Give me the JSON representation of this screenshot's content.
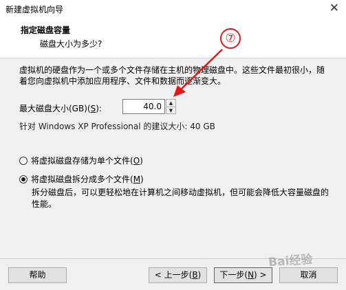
{
  "window": {
    "title": "新建虚拟机向导",
    "close_glyph": "✕"
  },
  "header": {
    "title": "指定磁盘容量",
    "subtitle": "磁盘大小为多少?"
  },
  "description": "虚拟机的硬盘作为一个或多个文件存储在主机的物理磁盘中。这些文件最初很小，随着您向虚拟机中添加应用程序、文件和数据而逐渐变大。",
  "disk_size": {
    "label_pre": "最大磁盘大小(GB)(",
    "label_key": "S",
    "label_post": "):",
    "value": "40.0"
  },
  "recommendation": "针对 Windows XP Professional 的建议大小: 40 GB",
  "options": {
    "single": {
      "label_pre": "将虚拟磁盘存储为单个文件(",
      "label_key": "O",
      "label_post": ")",
      "selected": false
    },
    "multi": {
      "label_pre": "将虚拟磁盘拆分成多个文件(",
      "label_key": "M",
      "label_post": ")",
      "selected": true
    },
    "multi_description": "拆分磁盘后，可以更轻松地在计算机之间移动虚拟机，但可能会降低大容量磁盘的性能。"
  },
  "buttons": {
    "help": "帮助",
    "back_pre": "< 上一步(",
    "back_key": "B",
    "back_post": ")",
    "next_pre": "下一步(",
    "next_key": "N",
    "next_post": ") >",
    "cancel": "取消"
  },
  "annotation": {
    "label": "⑦",
    "color": "#e01818"
  },
  "watermark": "Bai经验"
}
